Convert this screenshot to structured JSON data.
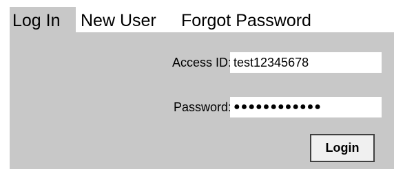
{
  "tabs": [
    {
      "label": "Log In",
      "active": true
    },
    {
      "label": "New User",
      "active": false
    },
    {
      "label": "Forgot Password",
      "active": false
    }
  ],
  "form": {
    "access_id_label": "Access ID:",
    "access_id_value": "test12345678",
    "password_label": "Password:",
    "password_masked": "●●●●●●●●●●●●",
    "login_button": "Login"
  },
  "colors": {
    "panel_background": "#c8c8c8",
    "input_background": "#ffffff",
    "button_background": "#f0f0f0",
    "button_border": "#404040"
  }
}
